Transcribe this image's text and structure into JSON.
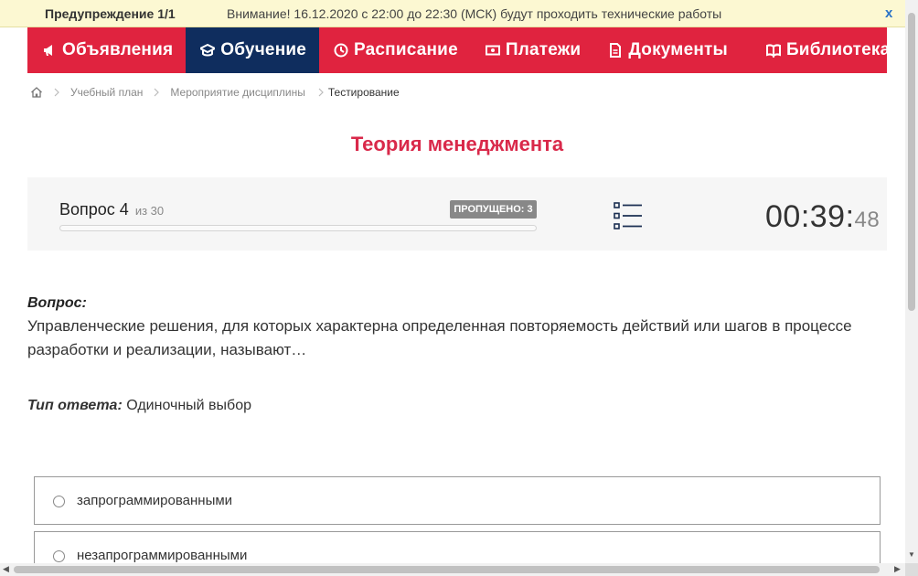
{
  "warning": {
    "title": "Предупреждение 1/1",
    "text": "Внимание! 16.12.2020 с 22:00 до 22:30 (МСК) будут проходить технические работы",
    "close": "x"
  },
  "nav": {
    "items": [
      {
        "label": "Объявления",
        "icon": "megaphone-icon"
      },
      {
        "label": "Обучение",
        "icon": "graduation-cap-icon",
        "active": true
      },
      {
        "label": "Расписание",
        "icon": "clock-icon"
      },
      {
        "label": "Платежи",
        "icon": "money-icon"
      },
      {
        "label": "Документы",
        "icon": "document-icon"
      },
      {
        "label": "Библиотека",
        "icon": "book-icon"
      }
    ]
  },
  "breadcrumb": {
    "items": [
      "Учебный план",
      "Мероприятие дисциплины"
    ],
    "current": "Тестирование"
  },
  "page_title": "Теория менеджмента",
  "progress": {
    "question_label": "Вопрос 4",
    "of_label": "из 30",
    "skipped": "ПРОПУЩЕНО: 3",
    "fraction": 0.0,
    "timer_main": "00:39:",
    "timer_sec": "48"
  },
  "question": {
    "heading": "Вопрос:",
    "text": "Управленческие решения, для которых характерна определенная повторяемость действий или шагов в процессе разработки и реализации, называют…",
    "answer_type_label": "Тип ответа:",
    "answer_type": "Одиночный выбор"
  },
  "options": [
    {
      "label": "запрограммированными"
    },
    {
      "label": "незапрограммированными"
    }
  ],
  "colors": {
    "brand_red": "#e0233f",
    "nav_active": "#0f2d5e",
    "title_red": "#d9294a",
    "warning_bg": "#fcf8d2"
  }
}
